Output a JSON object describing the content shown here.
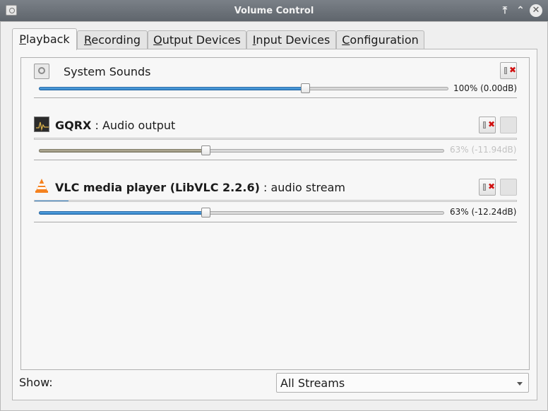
{
  "window": {
    "title": "Volume Control"
  },
  "tabs": [
    {
      "label_first": "P",
      "label_rest": "layback"
    },
    {
      "label_first": "R",
      "label_rest": "ecording"
    },
    {
      "label_first": "O",
      "label_rest": "utput Devices"
    },
    {
      "label_first": "I",
      "label_rest": "nput Devices"
    },
    {
      "label_first": "C",
      "label_rest": "onfiguration"
    }
  ],
  "streams": [
    {
      "app": "System Sounds",
      "detail": "",
      "icon": "system-sounds-icon",
      "volume_fraction": 0.65,
      "volume_text": "100% (0.00dB)",
      "enabled": true,
      "muted": false
    },
    {
      "app": "GQRX",
      "detail": ": Audio output",
      "icon": "gqrx-icon",
      "volume_fraction": 0.41,
      "volume_text": "63% (-11.94dB)",
      "enabled": false,
      "muted": true,
      "meter_fraction": 0.0
    },
    {
      "app": "VLC media player (LibVLC 2.2.6)",
      "detail": ": audio stream",
      "icon": "vlc-cone-icon",
      "volume_fraction": 0.41,
      "volume_text": "63% (-12.24dB)",
      "enabled": true,
      "muted": false,
      "meter_fraction": 0.07
    }
  ],
  "footer": {
    "show_label": "Show:",
    "show_value": "All Streams"
  },
  "colors": {
    "accent": "#3d8ad0",
    "titlebar": "#6a7077",
    "mute_x": "#d01010"
  }
}
